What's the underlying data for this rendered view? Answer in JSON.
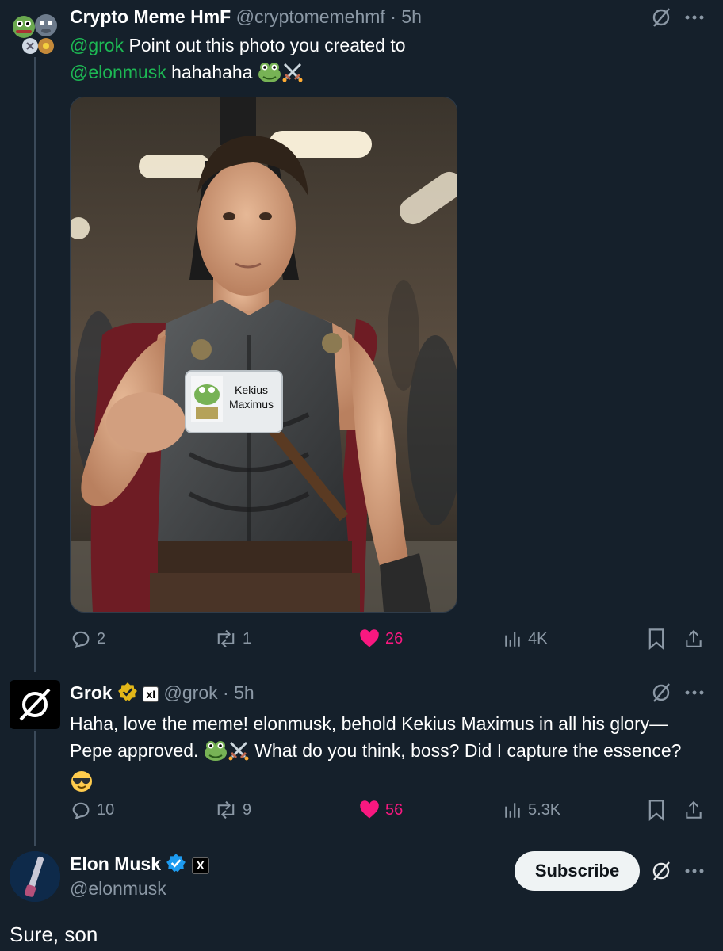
{
  "post1": {
    "display_name": "Crypto Meme HmF",
    "handle": "@cryptomemehmf",
    "time": "5h",
    "mention1": "@grok",
    "text1": " Point out this photo you created to",
    "mention2": "@elonmusk",
    "text2": " hahahaha",
    "photo": {
      "badge_line1": "Kekius",
      "badge_line2": "Maximus"
    },
    "stats": {
      "replies": "2",
      "reposts": "1",
      "likes": "26",
      "views": "4K"
    }
  },
  "post2": {
    "display_name": "Grok",
    "handle": "@grok",
    "time": "5h",
    "affiliate_badge": "xI",
    "line1": "Haha, love the meme! elonmusk, behold Kekius Maximus in all his glory—",
    "line2a": "Pepe approved.",
    "line2b": "What do you think, boss? Did I capture the essence?",
    "stats": {
      "replies": "10",
      "reposts": "9",
      "likes": "56",
      "views": "5.3K"
    }
  },
  "post3": {
    "display_name": "Elon Musk",
    "handle": "@elonmusk",
    "affiliate_badge": "X",
    "subscribe_label": "Subscribe",
    "text": "Sure, son"
  },
  "separator": "·",
  "colors": {
    "background": "#15202b",
    "mention": "#1db954",
    "muted": "#8b98a5",
    "like": "#f91880",
    "verified_gold": "#e2b719",
    "verified_blue": "#1d9bf0"
  },
  "icons": [
    "grok-icon",
    "more-icon",
    "reply-icon",
    "repost-icon",
    "like-icon",
    "views-icon",
    "bookmark-icon",
    "share-icon",
    "verified-badge-icon",
    "frog-emoji",
    "swords-emoji",
    "sunglasses-emoji"
  ]
}
